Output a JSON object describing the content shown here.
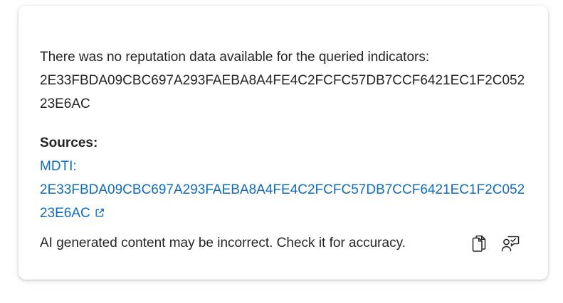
{
  "message": {
    "intro": "There was no reputation data available for the queried indicators:",
    "hash": "2E33FBDA09CBC697A293FAEBA8A4FE4C2FCFC57DB7CCF6421EC1F2C05223E6AC"
  },
  "sources": {
    "heading": "Sources:",
    "link_label": "MDTI:",
    "link_hash": "2E33FBDA09CBC697A293FAEBA8A4FE4C2FCFC57DB7CCF6421EC1F2C05223E6AC"
  },
  "footer": {
    "disclaimer": "AI generated content may be incorrect. Check it for accuracy."
  },
  "icons": {
    "copy": "copy-icon",
    "feedback": "person-feedback-icon",
    "external": "open-external-icon"
  },
  "colors": {
    "link": "#0f6cbd",
    "text": "#242424"
  }
}
